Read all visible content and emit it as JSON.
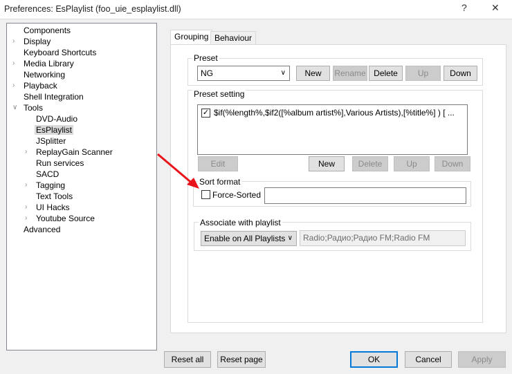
{
  "window": {
    "title": "Preferences: EsPlaylist (foo_uie_esplaylist.dll)",
    "help": "?",
    "close": "✕"
  },
  "tree": [
    {
      "label": "Components",
      "level": 0,
      "expander": ""
    },
    {
      "label": "Display",
      "level": 0,
      "expander": "collapsed"
    },
    {
      "label": "Keyboard Shortcuts",
      "level": 0,
      "expander": ""
    },
    {
      "label": "Media Library",
      "level": 0,
      "expander": "collapsed"
    },
    {
      "label": "Networking",
      "level": 0,
      "expander": ""
    },
    {
      "label": "Playback",
      "level": 0,
      "expander": "collapsed"
    },
    {
      "label": "Shell Integration",
      "level": 0,
      "expander": ""
    },
    {
      "label": "Tools",
      "level": 0,
      "expander": "expanded"
    },
    {
      "label": "DVD-Audio",
      "level": 1,
      "expander": ""
    },
    {
      "label": "EsPlaylist",
      "level": 1,
      "expander": "",
      "selected": true
    },
    {
      "label": "JSplitter",
      "level": 1,
      "expander": ""
    },
    {
      "label": "ReplayGain Scanner",
      "level": 1,
      "expander": "collapsed"
    },
    {
      "label": "Run services",
      "level": 1,
      "expander": ""
    },
    {
      "label": "SACD",
      "level": 1,
      "expander": ""
    },
    {
      "label": "Tagging",
      "level": 1,
      "expander": "collapsed"
    },
    {
      "label": "Text Tools",
      "level": 1,
      "expander": ""
    },
    {
      "label": "UI Hacks",
      "level": 1,
      "expander": "collapsed"
    },
    {
      "label": "Youtube Source",
      "level": 1,
      "expander": "collapsed"
    },
    {
      "label": "Advanced",
      "level": 0,
      "expander": ""
    }
  ],
  "tabs": {
    "grouping": "Grouping",
    "behaviour": "Behaviour"
  },
  "preset": {
    "label": "Preset",
    "selected": "NG",
    "new": "New",
    "rename": "Rename",
    "delete": "Delete",
    "up": "Up",
    "down": "Down"
  },
  "preset_setting": {
    "label": "Preset setting",
    "item": "$if(%length%,$if2([%album artist%],Various Artists),[%title%] ) [ ...",
    "item_checked": true,
    "edit": "Edit",
    "new": "New",
    "delete": "Delete",
    "up": "Up",
    "down": "Down"
  },
  "sort_format": {
    "label": "Sort format",
    "checkbox": "Force-Sorted",
    "checked": false,
    "value": ""
  },
  "associate": {
    "label": "Associate with playlist",
    "selected": "Enable on All Playlists",
    "playlists": "Radio;Радио;Радио FM;Radio FM"
  },
  "footer": {
    "reset_all": "Reset all",
    "reset_page": "Reset page",
    "ok": "OK",
    "cancel": "Cancel",
    "apply": "Apply"
  },
  "colors": {
    "annotation_arrow": "#e8141a",
    "ok_border": "#0078d7"
  }
}
